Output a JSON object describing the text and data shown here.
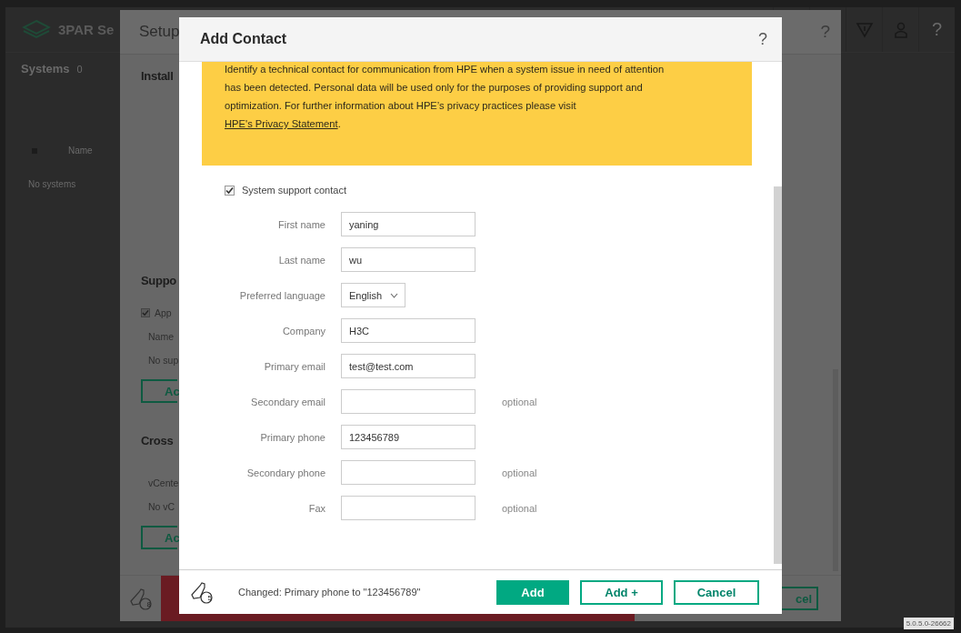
{
  "app": {
    "brand": "3PAR Se",
    "help": "?",
    "systems": {
      "title": "Systems",
      "count": "0",
      "columns": [
        "Name"
      ],
      "empty": "No systems"
    },
    "version": "5.0.5.0-26662"
  },
  "setup_dialog": {
    "title": "Setup",
    "help": "?",
    "sections": [
      {
        "title": "Install"
      },
      {
        "title": "Suppo",
        "checkbox": {
          "label": "App",
          "checked": true
        },
        "column": "Name",
        "empty": "No sup",
        "button": "Ac"
      },
      {
        "title": "Cross",
        "column": "vCente",
        "empty": "No vC",
        "button": "Ac"
      }
    ],
    "footer_badge": "8",
    "footer_button": "cel"
  },
  "add_contact": {
    "title": "Add Contact",
    "help": "?",
    "notice": {
      "text": "Identify a technical contact for communication from HPE when a system issue in need of attention has been detected. Personal data will be used only for the purposes of providing support and optimization. For further information about HPE’s privacy practices please visit ",
      "link": "HPE's Privacy Statement",
      "after": "."
    },
    "support_contact": {
      "label": "System support contact",
      "checked": true
    },
    "fields": [
      {
        "kind": "text",
        "label": "First name",
        "value": "yaning"
      },
      {
        "kind": "text",
        "label": "Last name",
        "value": "wu"
      },
      {
        "kind": "select",
        "label": "Preferred language",
        "value": "English"
      },
      {
        "kind": "text",
        "label": "Company",
        "value": "H3C"
      },
      {
        "kind": "text",
        "label": "Primary email",
        "value": "test@test.com"
      },
      {
        "kind": "text",
        "label": "Secondary email",
        "note": "optional"
      },
      {
        "kind": "text",
        "label": "Primary phone",
        "value": "123456789"
      },
      {
        "kind": "text",
        "label": "Secondary phone",
        "note": "optional"
      },
      {
        "kind": "text",
        "label": "Fax",
        "note": "optional"
      }
    ],
    "footer": {
      "badge": "5",
      "status": "Changed: Primary phone to \"123456789\"",
      "buttons": [
        {
          "label": "Add",
          "kind": "primary"
        },
        {
          "label": "Add +",
          "kind": "secondary"
        },
        {
          "label": "Cancel",
          "kind": "secondary"
        }
      ]
    }
  }
}
